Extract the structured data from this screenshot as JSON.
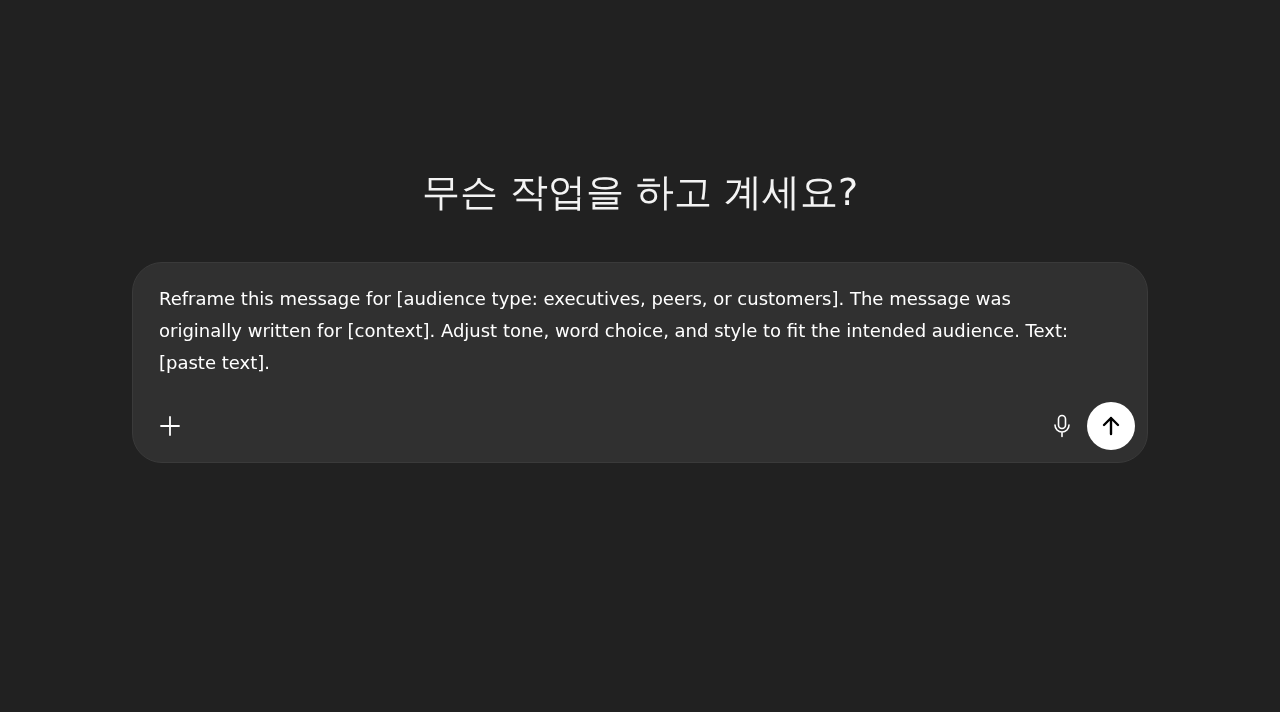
{
  "heading": "무슨 작업을 하고 계세요?",
  "composer": {
    "value": "Reframe this message for [audience type: executives, peers, or customers]. The message was originally written for [context]. Adjust tone, word choice, and style to fit the intended audience. Text: [paste text]."
  }
}
